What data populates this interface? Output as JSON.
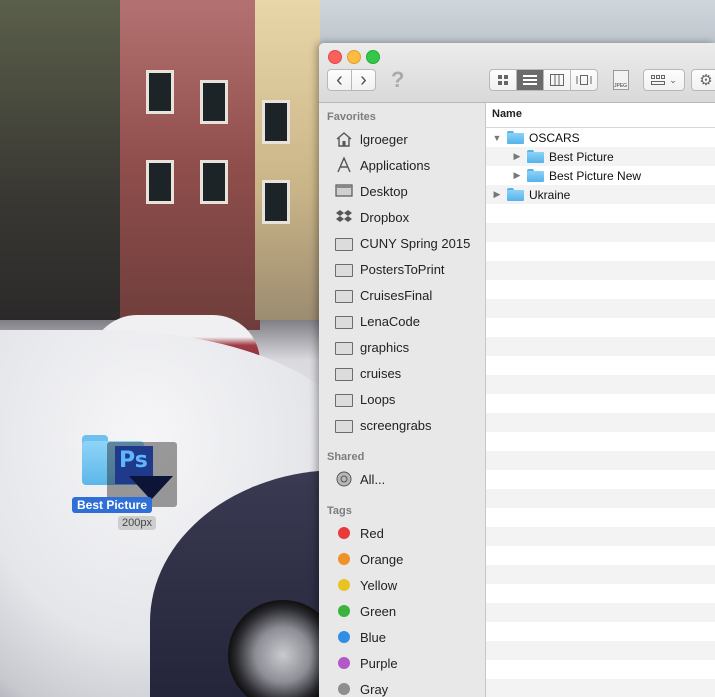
{
  "drag": {
    "label": "Best Picture",
    "size_badge": "200px",
    "badge_text": "Ps"
  },
  "finder": {
    "toolbar": {
      "back_icon": "‹",
      "forward_icon": "›",
      "help_icon": "?",
      "jpeg_text": "JPEG"
    },
    "sidebar": {
      "favorites_heading": "Favorites",
      "favorites": [
        {
          "label": "lgroeger",
          "icon": "home-icon"
        },
        {
          "label": "Applications",
          "icon": "applications-icon"
        },
        {
          "label": "Desktop",
          "icon": "desktop-icon"
        },
        {
          "label": "Dropbox",
          "icon": "dropbox-icon"
        },
        {
          "label": "CUNY Spring 2015",
          "icon": "folder-icon"
        },
        {
          "label": "PostersToPrint",
          "icon": "folder-icon"
        },
        {
          "label": "CruisesFinal",
          "icon": "folder-icon"
        },
        {
          "label": "LenaCode",
          "icon": "folder-icon"
        },
        {
          "label": "graphics",
          "icon": "folder-icon"
        },
        {
          "label": "cruises",
          "icon": "folder-icon"
        },
        {
          "label": "Loops",
          "icon": "folder-icon"
        },
        {
          "label": "screengrabs",
          "icon": "folder-icon"
        }
      ],
      "shared_heading": "Shared",
      "shared": [
        {
          "label": "All...",
          "icon": "network-icon"
        }
      ],
      "tags_heading": "Tags",
      "tags": [
        {
          "label": "Red",
          "color": "#e83a3a"
        },
        {
          "label": "Orange",
          "color": "#f0912a"
        },
        {
          "label": "Yellow",
          "color": "#e9c223"
        },
        {
          "label": "Green",
          "color": "#3cb33c"
        },
        {
          "label": "Blue",
          "color": "#2f8ee6"
        },
        {
          "label": "Purple",
          "color": "#b457c9"
        },
        {
          "label": "Gray",
          "color": "#8e8e8e"
        }
      ]
    },
    "list": {
      "column_name": "Name",
      "rows": [
        {
          "name": "OSCARS",
          "level": 0,
          "expanded": true
        },
        {
          "name": "Best Picture",
          "level": 1,
          "expanded": false
        },
        {
          "name": "Best Picture New",
          "level": 1,
          "expanded": false
        },
        {
          "name": "Ukraine",
          "level": 0,
          "expanded": false
        }
      ]
    }
  }
}
